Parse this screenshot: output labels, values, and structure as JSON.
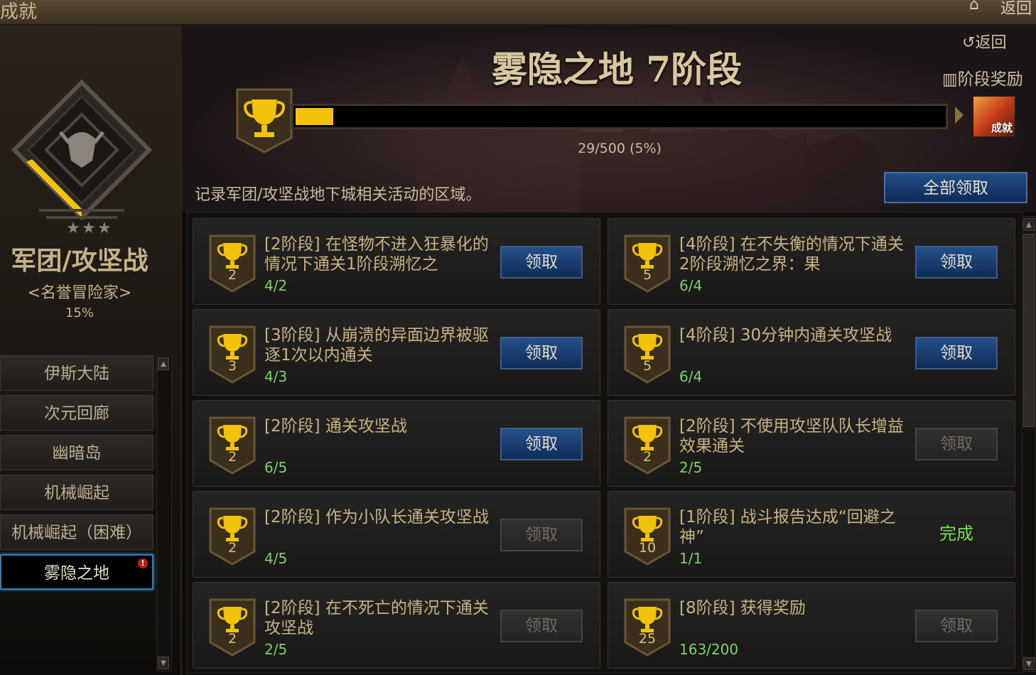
{
  "window": {
    "title": "成就",
    "home_icon": "home-icon",
    "back_label": "返回"
  },
  "sidebar": {
    "category_name": "军团/攻坚战",
    "category_title": "<名誉冒险家>",
    "category_percent": "15%",
    "emblem_stars": 3,
    "items": [
      {
        "label": "伊斯大陆",
        "active": false
      },
      {
        "label": "次元回廊",
        "active": false
      },
      {
        "label": "幽暗岛",
        "active": false
      },
      {
        "label": "机械崛起",
        "active": false
      },
      {
        "label": "机械崛起（困难）",
        "active": false
      },
      {
        "label": "雾隐之地",
        "active": true,
        "alert": "!"
      }
    ]
  },
  "header": {
    "stage_title": "雾隐之地  7阶段",
    "back_label": "返回",
    "stage_reward_label": "阶段奖励",
    "progress_current": 29,
    "progress_total": 500,
    "progress_fraction": 0.058,
    "progress_text": "29/500 (5%)",
    "reward_icon_label": "成就",
    "description": "记录军团/攻坚战地下城相关活动的区域。",
    "claim_all_label": "全部领取"
  },
  "achievements": [
    {
      "points": "2",
      "name": "[2阶段] 在怪物不进入狂暴化的情况下通关1阶段溯忆之",
      "count": "4/2",
      "button": "领取",
      "state": "on"
    },
    {
      "points": "5",
      "name": "[4阶段] 在不失衡的情况下通关2阶段溯忆之界：果",
      "count": "6/4",
      "button": "领取",
      "state": "on"
    },
    {
      "points": "3",
      "name": "[3阶段] 从崩溃的异面边界被驱逐1次以内通关",
      "count": "4/3",
      "button": "领取",
      "state": "on"
    },
    {
      "points": "5",
      "name": "[4阶段] 30分钟内通关攻坚战",
      "count": "6/4",
      "button": "领取",
      "state": "on"
    },
    {
      "points": "2",
      "name": "[2阶段] 通关攻坚战",
      "count": "6/5",
      "button": "领取",
      "state": "on"
    },
    {
      "points": "2",
      "name": "[2阶段] 不使用攻坚队队长增益效果通关",
      "count": "2/5",
      "button": "领取",
      "state": "off"
    },
    {
      "points": "2",
      "name": "[2阶段] 作为小队长通关攻坚战",
      "count": "4/5",
      "button": "领取",
      "state": "off"
    },
    {
      "points": "10",
      "name": "[1阶段] 战斗报告达成“回避之神”",
      "count": "1/1",
      "button": "完成",
      "state": "done"
    },
    {
      "points": "2",
      "name": "[2阶段] 在不死亡的情况下通关攻坚战",
      "count": "2/5",
      "button": "领取",
      "state": "off"
    },
    {
      "points": "25",
      "name": "[8阶段] 获得奖励",
      "count": "163/200",
      "button": "领取",
      "state": "off"
    }
  ],
  "colors": {
    "accent_gold": "#f3c30c",
    "button_blue": "#24508a",
    "done_green": "#6fe04f"
  }
}
